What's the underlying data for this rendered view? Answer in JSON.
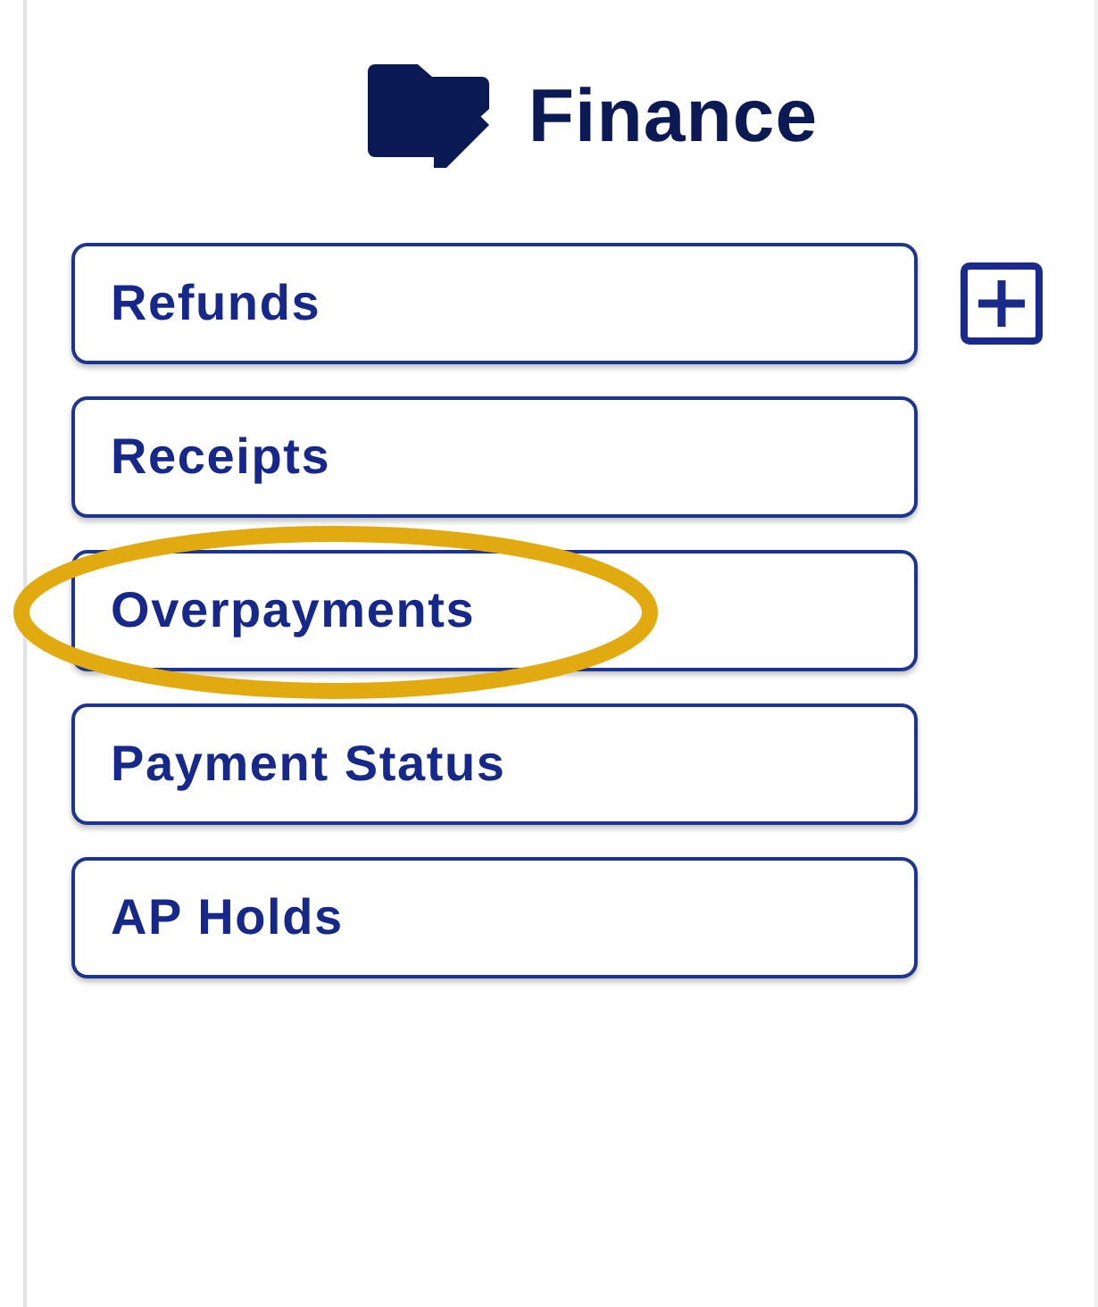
{
  "header": {
    "title": "Finance"
  },
  "items": [
    {
      "label": "Refunds",
      "highlighted": false
    },
    {
      "label": "Receipts",
      "highlighted": false
    },
    {
      "label": "Overpayments",
      "highlighted": true
    },
    {
      "label": "Payment Status",
      "highlighted": false
    },
    {
      "label": "AP Holds",
      "highlighted": false
    }
  ]
}
